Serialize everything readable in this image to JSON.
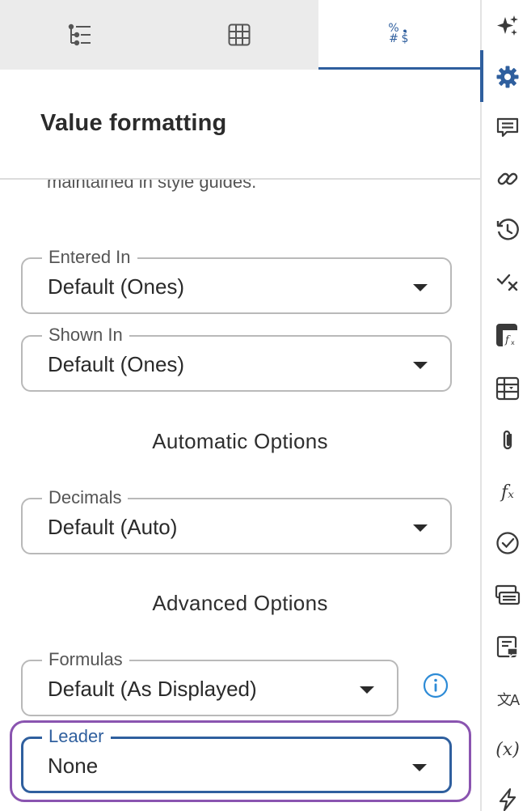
{
  "tabs": [
    {
      "icon": "tree-list-icon",
      "active": false
    },
    {
      "icon": "grid-table-icon",
      "active": false
    },
    {
      "icon": "number-format-icon",
      "active": true,
      "glyphs": [
        "%",
        "❟",
        "#",
        "$"
      ]
    }
  ],
  "header": {
    "title": "Value formatting"
  },
  "clipped_text": "maintained in style guides.",
  "fields": {
    "entered_in": {
      "label": "Entered In",
      "value": "Default (Ones)"
    },
    "shown_in": {
      "label": "Shown In",
      "value": "Default (Ones)"
    },
    "decimals": {
      "label": "Decimals",
      "value": "Default (Auto)"
    },
    "formulas": {
      "label": "Formulas",
      "value": "Default (As Displayed)"
    },
    "leader": {
      "label": "Leader",
      "value": "None"
    }
  },
  "sections": {
    "automatic": "Automatic Options",
    "advanced": "Advanced Options"
  },
  "rail": {
    "items": [
      "sparkle-icon",
      "gear-icon",
      "comment-icon",
      "link-icon",
      "history-icon",
      "check-x-icon",
      "table-formula-icon",
      "table-dropdown-icon",
      "paperclip-icon",
      "function-icon",
      "check-circle-icon",
      "cards-icon",
      "note-comment-icon",
      "translate-icon",
      "variable-icon",
      "lightning-icon"
    ],
    "function_text": "𝑓ₓ",
    "variable_text": "(x)",
    "translate_text": "文A",
    "active": "gear-icon"
  },
  "colors": {
    "accent": "#2f5f9e",
    "focus_ring": "#8a54b0",
    "info": "#2d8bd6",
    "tab_inactive_bg": "#ebebeb"
  }
}
